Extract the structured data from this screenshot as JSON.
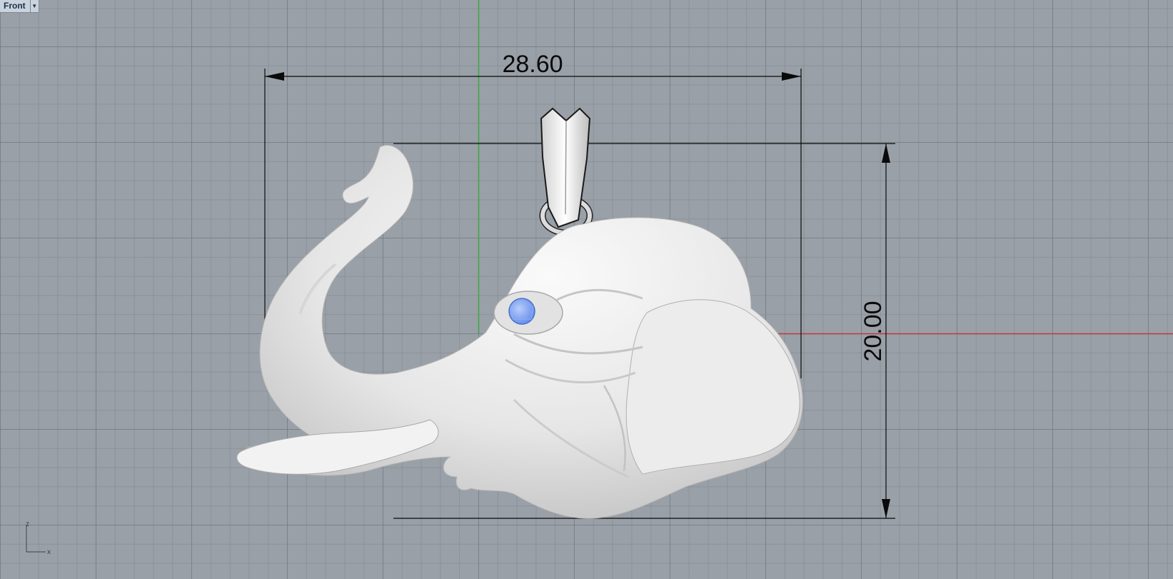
{
  "viewport": {
    "name": "Front",
    "menu_icon": "dropdown-caret-icon"
  },
  "dimensions": {
    "width_value": "28.60",
    "height_value": "20.00"
  },
  "axes": {
    "vertical_label": "z",
    "horizontal_label": "x",
    "x_axis_color": "#c0393b",
    "z_axis_color": "#3ca845"
  },
  "model": {
    "description_icon": "elephant-head-pendant",
    "gem_color": "#6f97f0"
  }
}
